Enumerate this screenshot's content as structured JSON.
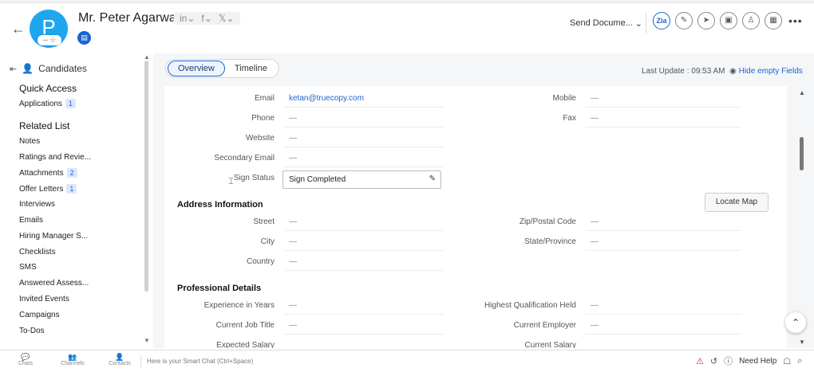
{
  "header": {
    "avatar_letter": "P",
    "avatar_sub": "-- ☆",
    "name": "Mr. Peter Agarwal",
    "social": [
      "in⌄",
      "f⌄",
      "𝕏⌄"
    ],
    "send_document": "Send Docume...",
    "icons": [
      "zia-icon",
      "edit-note-icon",
      "send-icon",
      "briefcase-icon",
      "user-check-icon",
      "calendar-icon"
    ],
    "zia_label": "Zia"
  },
  "sidebar": {
    "module": "Candidates",
    "quick_access": "Quick Access",
    "applications": {
      "label": "Applications",
      "count": "1"
    },
    "related_list": "Related List",
    "items": [
      {
        "label": "Notes",
        "count": ""
      },
      {
        "label": "Ratings and Revie...",
        "count": ""
      },
      {
        "label": "Attachments",
        "count": "2"
      },
      {
        "label": "Offer Letters",
        "count": "1"
      },
      {
        "label": "Interviews",
        "count": ""
      },
      {
        "label": "Emails",
        "count": ""
      },
      {
        "label": "Hiring Manager S...",
        "count": ""
      },
      {
        "label": "Checklists",
        "count": ""
      },
      {
        "label": "SMS",
        "count": ""
      },
      {
        "label": "Answered Assess...",
        "count": ""
      },
      {
        "label": "Invited Events",
        "count": ""
      },
      {
        "label": "Campaigns",
        "count": ""
      },
      {
        "label": "To-Dos",
        "count": ""
      }
    ]
  },
  "tabs": {
    "overview": "Overview",
    "timeline": "Timeline"
  },
  "last_update": "Last Update : 09:53 AM",
  "hide_empty": "Hide empty Fields",
  "fields": {
    "email": {
      "label": "Email",
      "value": "ketan@truecopy.com"
    },
    "mobile": {
      "label": "Mobile",
      "value": "—"
    },
    "phone": {
      "label": "Phone",
      "value": "—"
    },
    "fax": {
      "label": "Fax",
      "value": "—"
    },
    "website": {
      "label": "Website",
      "value": "—"
    },
    "secondary_email": {
      "label": "Secondary Email",
      "value": "—"
    },
    "sign_status": {
      "label": "Sign Status",
      "value": "Sign Completed"
    }
  },
  "address": {
    "title": "Address Information",
    "locate_map": "Locate Map",
    "street": {
      "label": "Street",
      "value": "—"
    },
    "zip": {
      "label": "Zip/Postal Code",
      "value": "—"
    },
    "city": {
      "label": "City",
      "value": "—"
    },
    "state": {
      "label": "State/Province",
      "value": "—"
    },
    "country": {
      "label": "Country",
      "value": "—"
    }
  },
  "professional": {
    "title": "Professional Details",
    "experience": {
      "label": "Experience in Years",
      "value": "—"
    },
    "qualification": {
      "label": "Highest Qualification Held",
      "value": "—"
    },
    "job_title": {
      "label": "Current Job Title",
      "value": "—"
    },
    "employer": {
      "label": "Current Employer",
      "value": "—"
    },
    "expected_salary": {
      "label": "Expected Salary",
      "value": ""
    },
    "current_salary": {
      "label": "Current Salary",
      "value": ""
    }
  },
  "footer": {
    "chats": "Chats",
    "channels": "Channels",
    "contacts": "Contacts",
    "smart_chat": "Here is your Smart Chat (Ctrl+Space)",
    "need_help": "Need Help"
  }
}
